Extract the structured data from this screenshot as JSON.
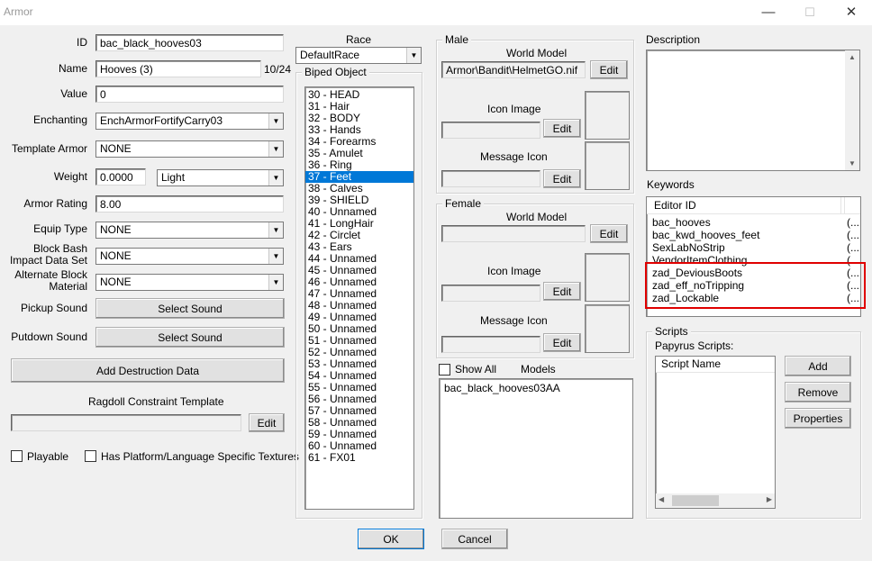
{
  "window": {
    "title": "Armor",
    "minimize": "—",
    "maximize": "☐",
    "close": "✕"
  },
  "form": {
    "id_label": "ID",
    "id_value": "bac_black_hooves03",
    "name_label": "Name",
    "name_value": "Hooves (3)",
    "name_count": "10/24",
    "value_label": "Value",
    "value_value": "0",
    "enchanting_label": "Enchanting",
    "enchanting_value": "EnchArmorFortifyCarry03",
    "template_label": "Template Armor",
    "template_value": "NONE",
    "weight_label": "Weight",
    "weight_value": "0.0000",
    "weight_class": "Light",
    "rating_label": "Armor Rating",
    "rating_value": "8.00",
    "equip_label": "Equip Type",
    "equip_value": "NONE",
    "blockbash_label_1": "Block Bash",
    "blockbash_label_2": "Impact Data Set",
    "blockbash_value": "NONE",
    "altblock_label_1": "Alternate Block",
    "altblock_label_2": "Material",
    "altblock_value": "NONE",
    "pickup_label": "Pickup Sound",
    "pickup_button": "Select Sound",
    "putdown_label": "Putdown Sound",
    "putdown_button": "Select Sound",
    "destruction_button": "Add Destruction Data",
    "ragdoll_label": "Ragdoll Constraint Template",
    "ragdoll_edit": "Edit",
    "playable_label": "Playable",
    "platform_label": "Has Platform/Language Specific Textures"
  },
  "race": {
    "label": "Race",
    "value": "DefaultRace"
  },
  "biped": {
    "legend": "Biped Object",
    "selected_index": 7,
    "items": [
      "30 - HEAD",
      "31 - Hair",
      "32 - BODY",
      "33 - Hands",
      "34 - Forearms",
      "35 - Amulet",
      "36 - Ring",
      "37 - Feet",
      "38 - Calves",
      "39 - SHIELD",
      "40 - Unnamed",
      "41 - LongHair",
      "42 - Circlet",
      "43 - Ears",
      "44 - Unnamed",
      "45 - Unnamed",
      "46 - Unnamed",
      "47 - Unnamed",
      "48 - Unnamed",
      "49 - Unnamed",
      "50 - Unnamed",
      "51 - Unnamed",
      "52 - Unnamed",
      "53 - Unnamed",
      "54 - Unnamed",
      "55 - Unnamed",
      "56 - Unnamed",
      "57 - Unnamed",
      "58 - Unnamed",
      "59 - Unnamed",
      "60 - Unnamed",
      "61 - FX01"
    ]
  },
  "male": {
    "legend": "Male",
    "world_model_label": "World Model",
    "world_model_value": "Armor\\Bandit\\HelmetGO.nif",
    "world_model_edit": "Edit",
    "icon_label": "Icon Image",
    "icon_edit": "Edit",
    "message_label": "Message Icon",
    "message_edit": "Edit"
  },
  "female": {
    "legend": "Female",
    "world_model_label": "World Model",
    "world_model_edit": "Edit",
    "icon_label": "Icon Image",
    "icon_edit": "Edit",
    "message_label": "Message Icon",
    "message_edit": "Edit"
  },
  "models": {
    "show_all_label": "Show All",
    "label": "Models",
    "items": [
      "bac_black_hooves03AA"
    ]
  },
  "description": {
    "label": "Description"
  },
  "keywords": {
    "label": "Keywords",
    "column": "Editor ID",
    "items": [
      {
        "name": "bac_hooves",
        "ell": "(..."
      },
      {
        "name": "bac_kwd_hooves_feet",
        "ell": "(..."
      },
      {
        "name": "SexLabNoStrip",
        "ell": "(..."
      },
      {
        "name": "VendorItemClothing",
        "ell": "(..."
      },
      {
        "name": "zad_DeviousBoots",
        "ell": "(..."
      },
      {
        "name": "zad_eff_noTripping",
        "ell": "(..."
      },
      {
        "name": "zad_Lockable",
        "ell": "(..."
      }
    ],
    "highlight_color": "#e00000"
  },
  "scripts": {
    "legend": "Scripts",
    "label": "Papyrus Scripts:",
    "column": "Script Name",
    "add": "Add",
    "remove": "Remove",
    "properties": "Properties"
  },
  "footer": {
    "ok": "OK",
    "cancel": "Cancel"
  }
}
